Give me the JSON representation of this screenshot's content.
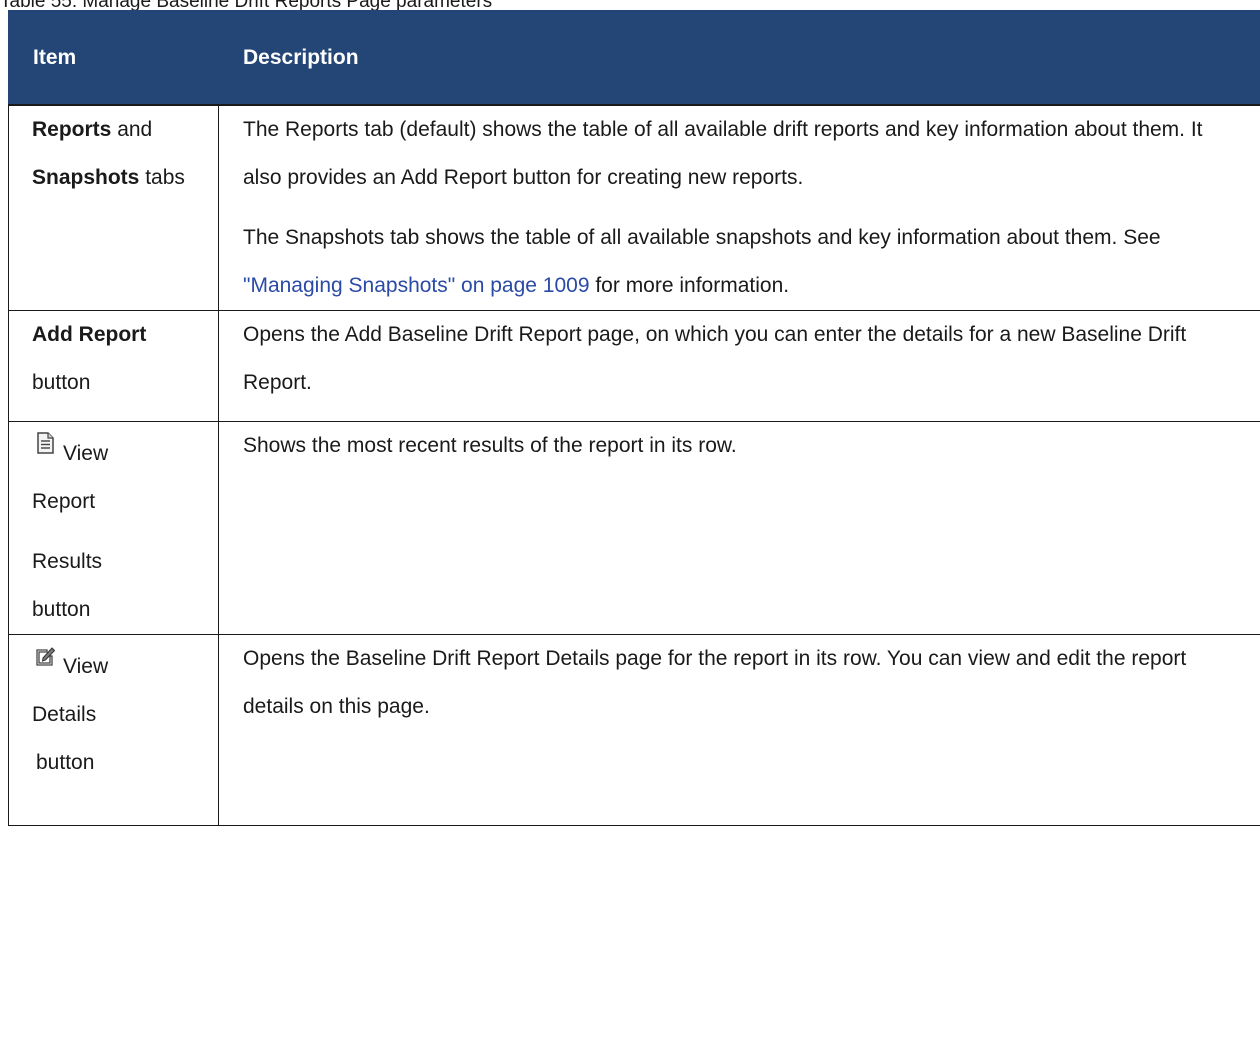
{
  "caption": "Table 55: Manage Baseline Drift Reports Page parameters",
  "headers": {
    "item": "Item",
    "description": "Description"
  },
  "rows": [
    {
      "item_bold1": "Reports",
      "item_and": "and",
      "item_bold2": "Snapshots",
      "item_tail": "tabs",
      "desc_p1": "The Reports tab (default) shows the table of all available drift reports and key information about them. It also provides an Add Report button for creating new reports.",
      "desc_p2_pre": "The Snapshots tab shows the table of all available snapshots and key information about them. See ",
      "desc_p2_link": "\"Managing Snapshots\" on page 1009",
      "desc_p2_post": " for more information."
    },
    {
      "item_bold": "Add Report",
      "item_tail": "button",
      "desc": "Opens the Add Baseline Drift Report page, on which you can enter the details for a new Baseline Drift Report."
    },
    {
      "icon": "report-page-icon",
      "item_line1": "View",
      "item_line2": "Report",
      "item_line3": "Results",
      "item_line4": "button",
      "desc": "Shows the most recent results of the report in its row."
    },
    {
      "icon": "edit-pencil-icon",
      "item_line1": "View",
      "item_line2": "Details",
      "item_line3": "button",
      "desc": "Opens the Baseline Drift Report Details page for the report in its row. You can view and edit the report details on this page."
    }
  ],
  "colors": {
    "header_bg": "#234676",
    "link": "#2a4aa6"
  }
}
